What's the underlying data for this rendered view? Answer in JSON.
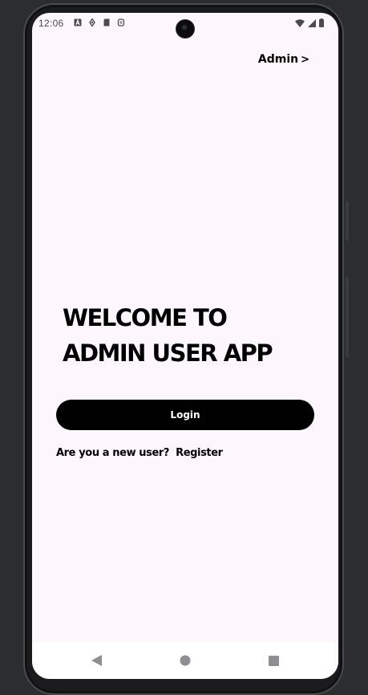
{
  "status_bar": {
    "time": "12:06",
    "left_icons": [
      "accessibility-a-icon",
      "data-saver-icon",
      "sd-card-icon",
      "cat-icon"
    ],
    "right_icons": [
      "wifi-icon",
      "cell-signal-icon",
      "battery-icon"
    ]
  },
  "header": {
    "admin_label": "Admin",
    "admin_chevron": ">"
  },
  "main": {
    "welcome_line1": "WELCOME TO",
    "welcome_line2": "ADMIN USER APP",
    "login_label": "Login",
    "new_user_prompt": "Are you a new user?",
    "register_label": "Register"
  },
  "nav_bar": {
    "buttons": [
      "back-icon",
      "home-icon",
      "recents-icon"
    ]
  },
  "colors": {
    "screen_background": "#fdf7fd",
    "primary": "#000000",
    "button_text": "#ffffff",
    "status_icons": "#4b4b4f",
    "nav_icons": "#8e8e93"
  }
}
